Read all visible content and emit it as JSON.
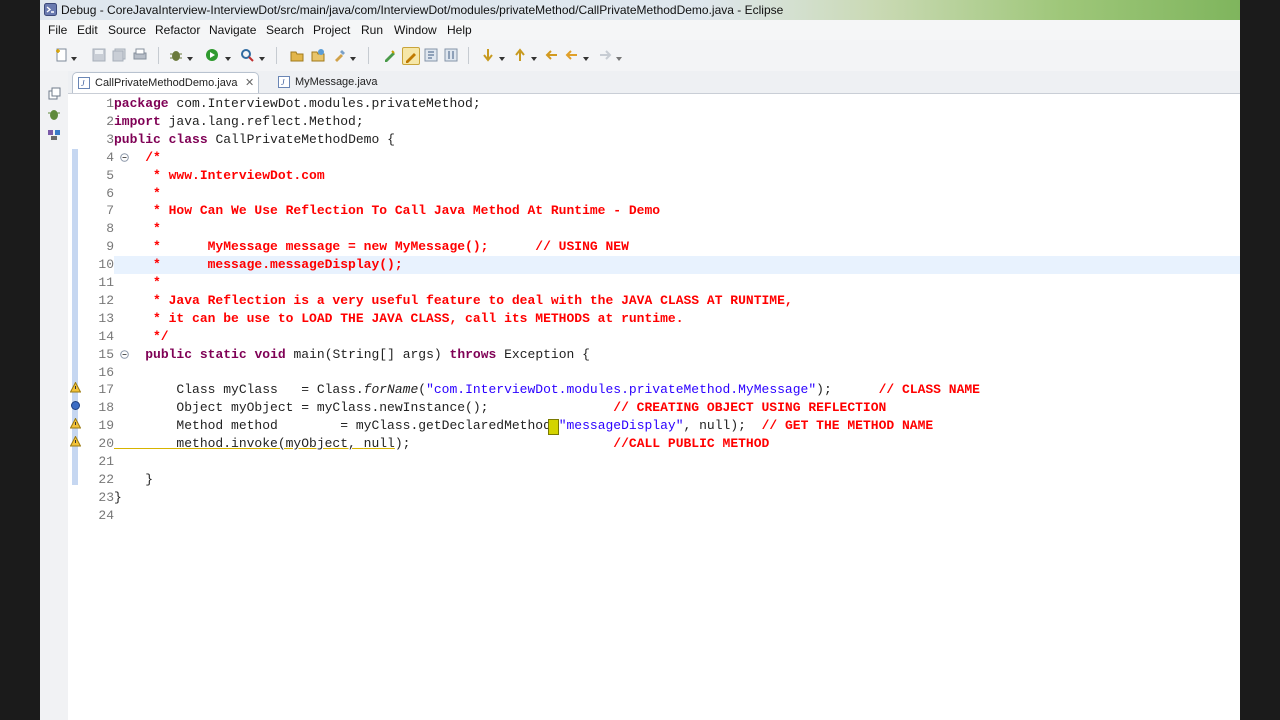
{
  "window": {
    "title": "Debug - CoreJavaInterview-InterviewDot/src/main/java/com/InterviewDot/modules/privateMethod/CallPrivateMethodDemo.java - Eclipse"
  },
  "menu": [
    {
      "label": "File"
    },
    {
      "label": "Edit"
    },
    {
      "label": "Source"
    },
    {
      "label": "Refactor"
    },
    {
      "label": "Navigate"
    },
    {
      "label": "Search"
    },
    {
      "label": "Project"
    },
    {
      "label": "Run"
    },
    {
      "label": "Window"
    },
    {
      "label": "Help"
    }
  ],
  "tabs": [
    {
      "label": "CallPrivateMethodDemo.java",
      "close": "✕",
      "active": true
    },
    {
      "label": "MyMessage.java",
      "active": false
    }
  ],
  "editor": {
    "line_numbers": [
      "1",
      "2",
      "3",
      "4",
      "5",
      "6",
      "7",
      "8",
      "9",
      "10",
      "11",
      "12",
      "13",
      "14",
      "15",
      "16",
      "17",
      "18",
      "19",
      "20",
      "21",
      "22",
      "23",
      "24"
    ],
    "current_line": "10",
    "code": {
      "l1_kw": "package",
      "l1_rest": " com.InterviewDot.modules.privateMethod;",
      "l2_kw": "import",
      "l2_rest": " java.lang.reflect.Method;",
      "l3_kw1": "public",
      "l3_kw2": "class",
      "l3_rest": " CallPrivateMethodDemo {",
      "l4": "    /*",
      "l5": "     * www.InterviewDot.com",
      "l6": "     *",
      "l7": "     * How Can We Use Reflection To Call Java Method At Runtime - Demo",
      "l8": "     *",
      "l9": "     *      MyMessage message = new MyMessage();      // USING NEW",
      "l10": "     *      message.messageDisplay();",
      "l11": "     *",
      "l12": "     * Java Reflection is a very useful feature to deal with the JAVA CLASS AT RUNTIME,",
      "l13": "     * it can be use to LOAD THE JAVA CLASS, call its METHODS at runtime.",
      "l14": "     */",
      "l15_indent": "    ",
      "l15_kw1": "public",
      "l15_kw2": "static",
      "l15_kw3": "void",
      "l15_mid": " main(String[] args) ",
      "l15_kw4": "throws",
      "l15_end": " Exception {",
      "l17_a": "        Class myClass   = Class.",
      "l17_b": "forName",
      "l17_c": "(",
      "l17_str": "\"com.InterviewDot.modules.privateMethod.MyMessage\"",
      "l17_d": ");      ",
      "l17_cm": "// CLASS NAME",
      "l18_a": "        Object myObject = myClass.newInstance();                ",
      "l18_cm": "// CREATING OBJECT USING REFLECTION",
      "l19_a": "        Method method        = myClass.getDeclaredMethod(",
      "l19_str": "\"messageDisplay\"",
      "l19_b": ", ",
      "l19_kw": "null",
      "l19_c": ");  ",
      "l19_cm": "// GET THE METHOD NAME",
      "l20_a": "        method.invoke(myObject, ",
      "l20_kw": "null",
      "l20_b": ");                          ",
      "l20_cm": "//CALL PUBLIC METHOD",
      "l22": "    }",
      "l23": "}"
    }
  },
  "colors": {
    "keyword": "#7f0055",
    "comment": "#ff0000",
    "string": "#2a00ff",
    "current_line": "#e8f2fe"
  }
}
